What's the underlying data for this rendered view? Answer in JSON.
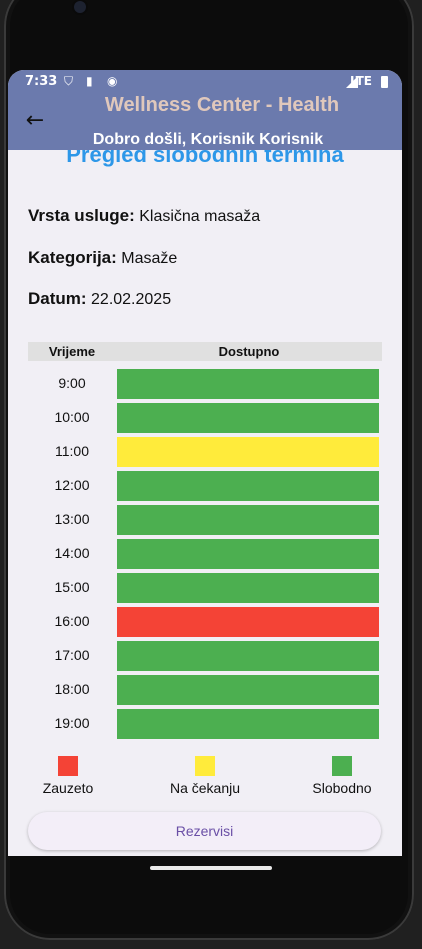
{
  "status": {
    "time": "7:33",
    "network": "LTE"
  },
  "appbar": {
    "title": "Wellness Center - Health",
    "welcome": "Dobro došli, Korisnik Korisnik"
  },
  "page": {
    "title": "Pregled slobodnih termina"
  },
  "info": {
    "service_label": "Vrsta usluge:",
    "service_value": "Klasična masaža",
    "category_label": "Kategorija:",
    "category_value": "Masaže",
    "date_label": "Datum:",
    "date_value": "22.02.2025"
  },
  "table": {
    "header_time": "Vrijeme",
    "header_available": "Dostupno",
    "slots": [
      {
        "time": "9:00",
        "status": "free"
      },
      {
        "time": "10:00",
        "status": "free"
      },
      {
        "time": "11:00",
        "status": "pending"
      },
      {
        "time": "12:00",
        "status": "free"
      },
      {
        "time": "13:00",
        "status": "free"
      },
      {
        "time": "14:00",
        "status": "free"
      },
      {
        "time": "15:00",
        "status": "free"
      },
      {
        "time": "16:00",
        "status": "taken"
      },
      {
        "time": "17:00",
        "status": "free"
      },
      {
        "time": "18:00",
        "status": "free"
      },
      {
        "time": "19:00",
        "status": "free"
      }
    ]
  },
  "colors": {
    "free": "#4caf50",
    "pending": "#ffeb3b",
    "taken": "#f44336"
  },
  "legend": {
    "taken": "Zauzeto",
    "pending": "Na čekanju",
    "free": "Slobodno"
  },
  "actions": {
    "reserve": "Rezervisi"
  }
}
